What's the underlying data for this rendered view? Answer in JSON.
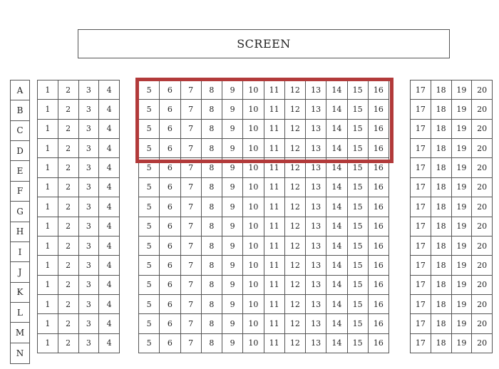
{
  "screen_label": "SCREEN",
  "rows": [
    "A",
    "B",
    "C",
    "D",
    "E",
    "F",
    "G",
    "H",
    "I",
    "J",
    "K",
    "L",
    "M",
    "N"
  ],
  "sections": {
    "left": [
      "1",
      "2",
      "3",
      "4"
    ],
    "center": [
      "5",
      "6",
      "7",
      "8",
      "9",
      "10",
      "11",
      "12",
      "13",
      "14",
      "15",
      "16"
    ],
    "right": [
      "17",
      "18",
      "19",
      "20"
    ]
  },
  "highlight": {
    "rows": [
      "A",
      "B",
      "C",
      "D"
    ],
    "seats_from": "5",
    "seats_to": "16",
    "color": "#b23a3a"
  }
}
